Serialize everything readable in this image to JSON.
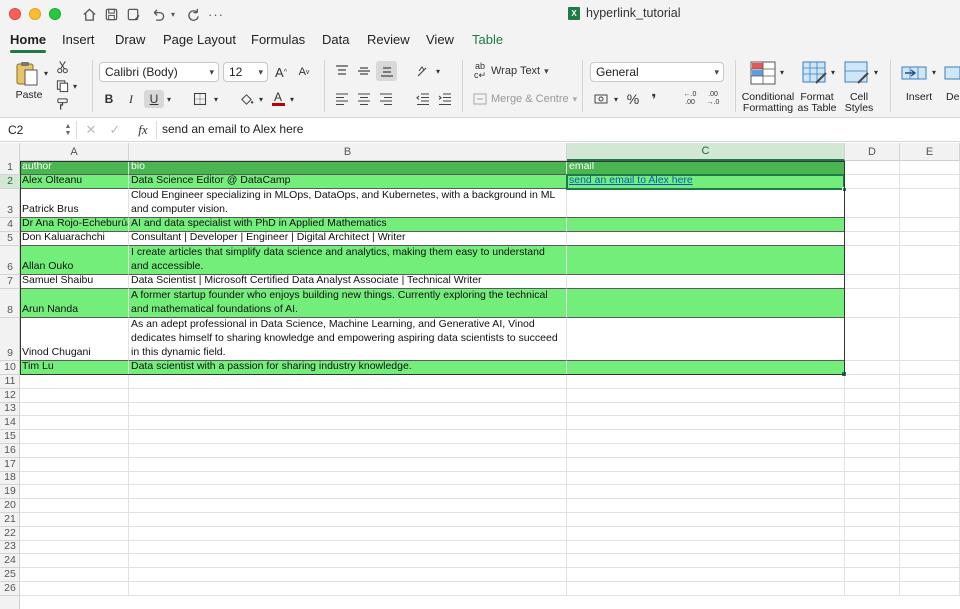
{
  "window": {
    "title": "hyperlink_tutorial"
  },
  "tabs": [
    "Home",
    "Insert",
    "Draw",
    "Page Layout",
    "Formulas",
    "Data",
    "Review",
    "View",
    "Table"
  ],
  "ribbon": {
    "paste_label": "Paste",
    "font_name": "Calibri (Body)",
    "font_size": "12",
    "wrap_text": "Wrap Text",
    "merge_centre": "Merge & Centre",
    "number_format": "General",
    "percent": "%",
    "comma": "❜",
    "cond_format_1": "Conditional",
    "cond_format_2": "Formatting",
    "format_table_1": "Format",
    "format_table_2": "as Table",
    "cell_styles_1": "Cell",
    "cell_styles_2": "Styles",
    "insert": "Insert",
    "delete": "De"
  },
  "formula_bar": {
    "cell_ref": "C2",
    "fx": "fx",
    "content": "send an email to Alex here"
  },
  "columns": [
    "A",
    "B",
    "C",
    "D",
    "E"
  ],
  "rows": [
    "1",
    "2",
    "3",
    "4",
    "5",
    "6",
    "7",
    "8",
    "9",
    "10",
    "11",
    "12",
    "13",
    "14",
    "15",
    "16",
    "17",
    "18",
    "19",
    "20",
    "21",
    "22",
    "23",
    "24",
    "25",
    "26"
  ],
  "table": {
    "headers": {
      "author": "author",
      "bio": "bio",
      "email": "email"
    },
    "data": [
      {
        "author": "Alex Olteanu",
        "bio": "Data Science Editor @ DataCamp",
        "email": "send an email to Alex here"
      },
      {
        "author": "Patrick Brus",
        "bio": "Cloud Engineer specializing in MLOps, DataOps, and Kubernetes, with a background in ML and computer vision.",
        "email": ""
      },
      {
        "author": "Dr Ana Rojo-Echeburúa",
        "bio": "AI and data specialist with PhD in Applied Mathematics",
        "email": ""
      },
      {
        "author": "Don Kaluarachchi",
        "bio": "Consultant | Developer | Engineer | Digital Architect | Writer",
        "email": ""
      },
      {
        "author": "Allan Ouko",
        "bio": "I create articles that simplify data science and analytics, making them easy to understand and accessible.",
        "email": ""
      },
      {
        "author": "Samuel Shaibu",
        "bio": "Data Scientist | Microsoft Certified Data Analyst Associate | Technical Writer",
        "email": ""
      },
      {
        "author": "Arun Nanda",
        "bio": "A former startup founder who enjoys building new things. Currently exploring the technical and mathematical foundations of AI.",
        "email": ""
      },
      {
        "author": "Vinod Chugani",
        "bio": "As an adept professional in Data Science, Machine Learning, and Generative AI, Vinod dedicates himself to sharing knowledge and empowering aspiring data scientists to succeed in this dynamic field.",
        "email": ""
      },
      {
        "author": "Tim Lu",
        "bio": "Data scientist with a passion for sharing industry knowledge.",
        "email": ""
      }
    ]
  },
  "colors": {
    "accent": "#1f7a45",
    "table_header": "#4bb552",
    "table_band": "#73ee7b",
    "link": "#1155cc"
  }
}
